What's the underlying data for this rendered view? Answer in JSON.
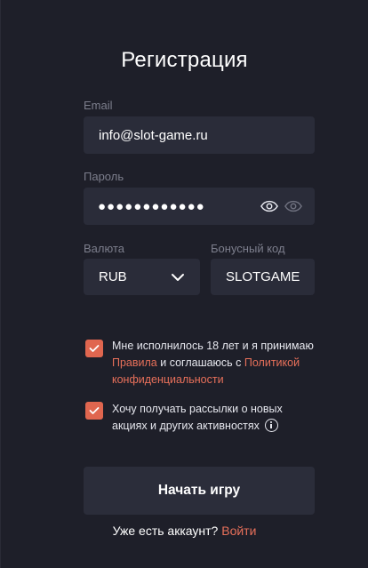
{
  "form": {
    "title": "Регистрация",
    "email": {
      "label": "Email",
      "value": "info@slot-game.ru"
    },
    "password": {
      "label": "Пароль",
      "masked_value": "●●●●●●●●●●●●"
    },
    "currency": {
      "label": "Валюта",
      "selected": "RUB"
    },
    "bonus": {
      "label": "Бонусный код",
      "value": "SLOTGAME"
    },
    "agree": {
      "checked": true,
      "line1": "Мне исполнилось 18 лет и я принимаю",
      "link_rules": "Правила",
      "middle": " и соглашаюсь с ",
      "link_policy_1": "Политикой",
      "link_policy_2": "конфиденциальности"
    },
    "newsletter": {
      "checked": true,
      "line1": "Хочу получать рассылки о новых",
      "line2": "акциях и других активностях"
    },
    "submit_label": "Начать игру",
    "footer": {
      "text": "Уже есть аккаунт? ",
      "link": "Войти"
    }
  },
  "colors": {
    "background": "#1e1f29",
    "field": "#2a2c39",
    "accent": "#e0664f",
    "label": "#7c7e8c"
  },
  "icons": [
    "eye-icon",
    "eye-icon-toggle",
    "chevron-down-icon",
    "check-icon",
    "info-icon"
  ]
}
